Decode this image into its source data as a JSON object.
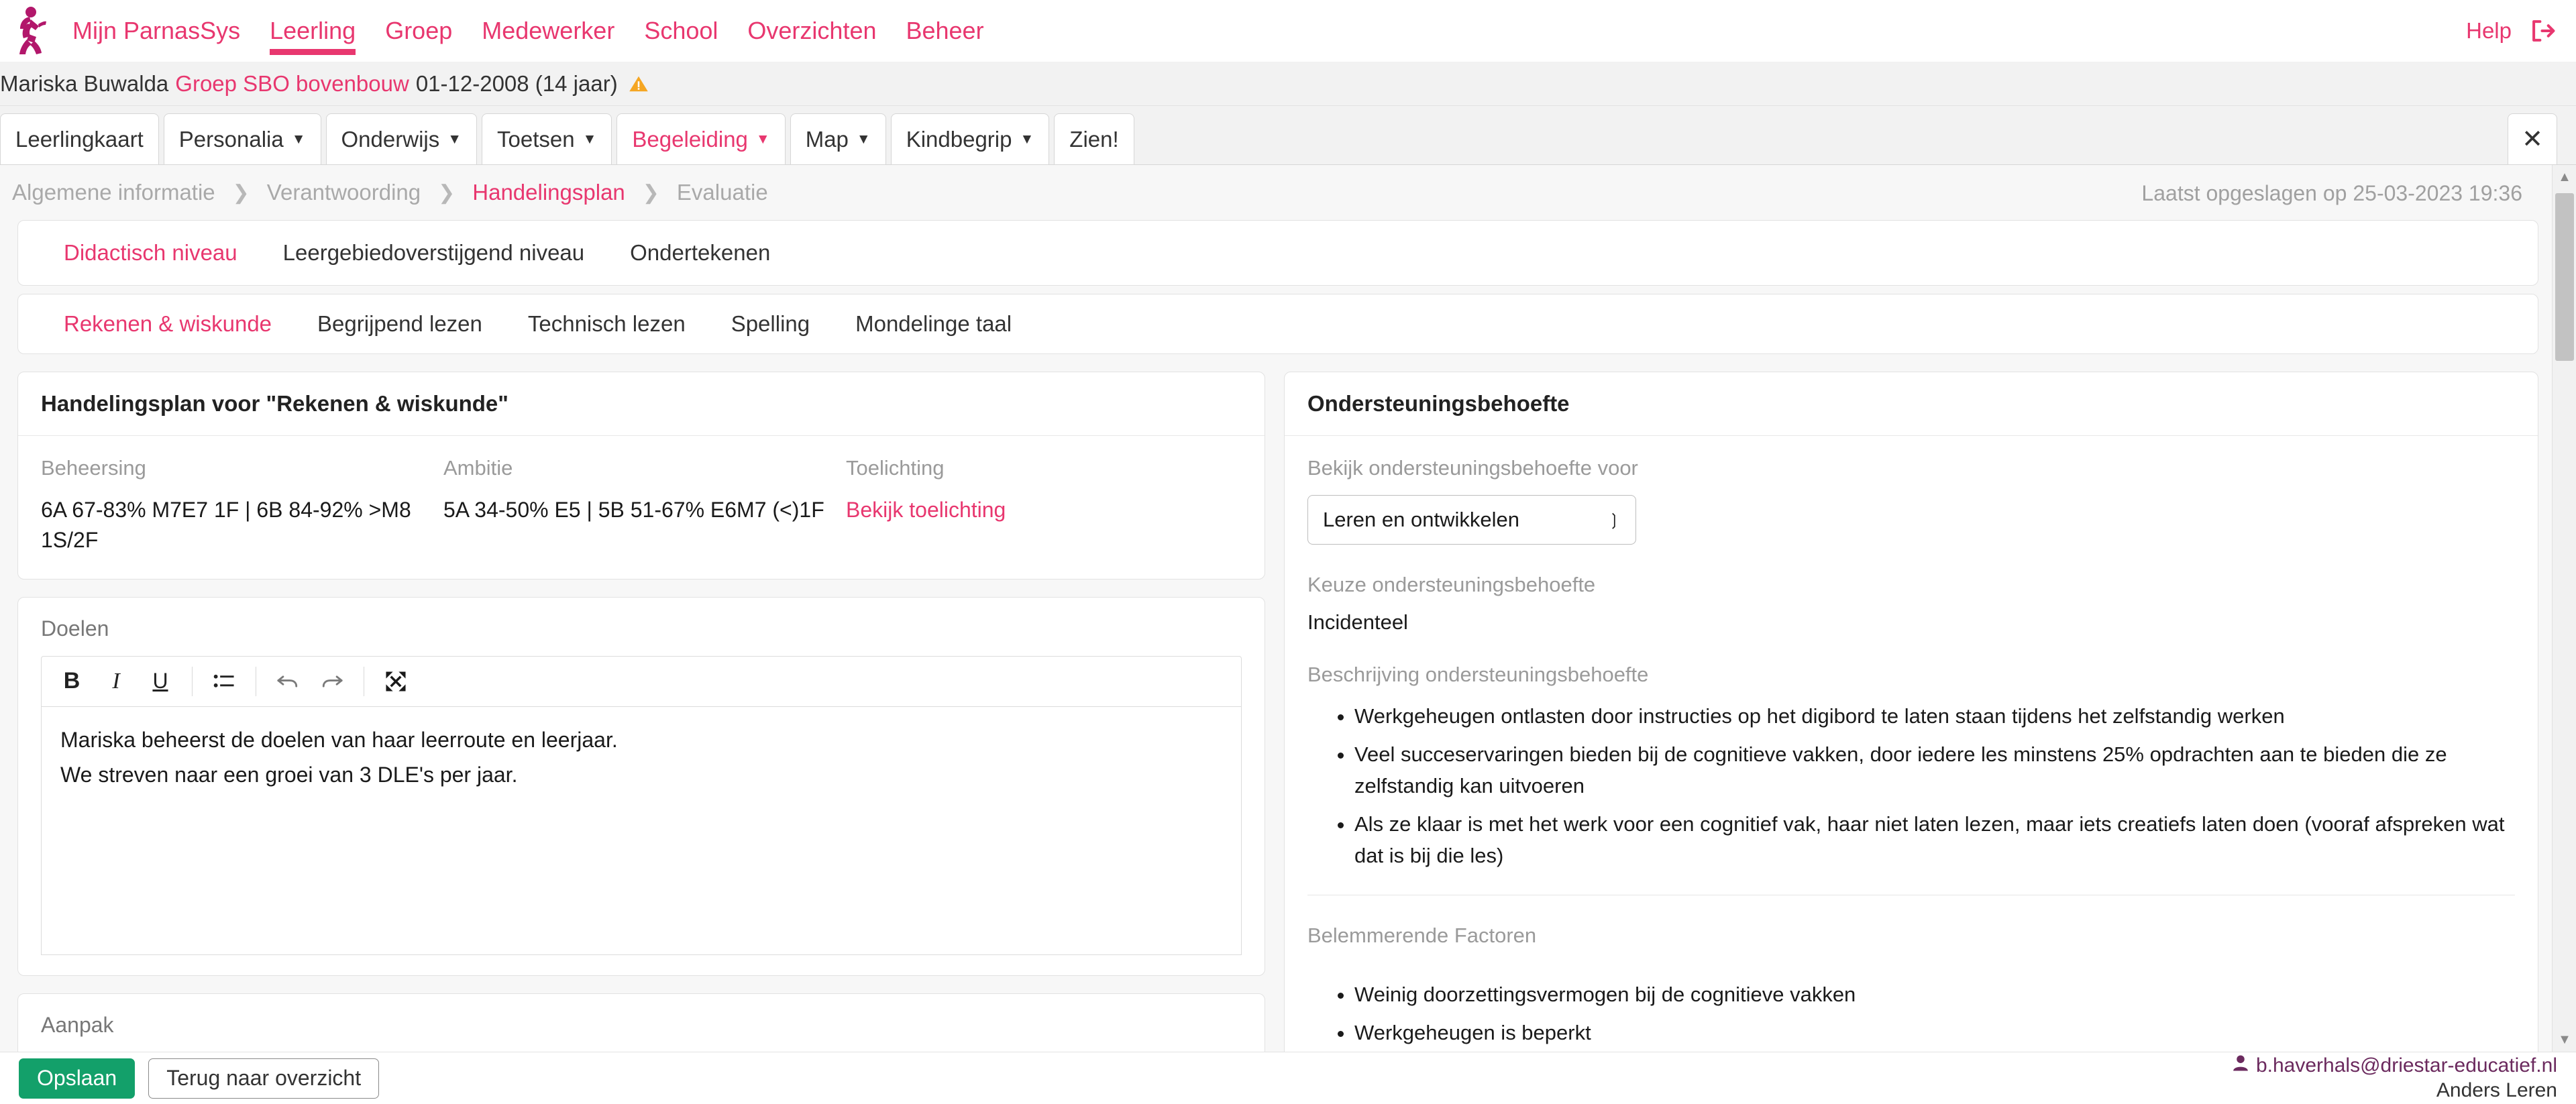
{
  "topnav": {
    "logo_alt": "parnassys-runner-logo",
    "items": [
      {
        "label": "Mijn ParnasSys",
        "active": false
      },
      {
        "label": "Leerling",
        "active": true
      },
      {
        "label": "Groep",
        "active": false
      },
      {
        "label": "Medewerker",
        "active": false
      },
      {
        "label": "School",
        "active": false
      },
      {
        "label": "Overzichten",
        "active": false
      },
      {
        "label": "Beheer",
        "active": false
      }
    ],
    "help_label": "Help"
  },
  "student": {
    "name": "Mariska Buwalda",
    "group": "Groep SBO bovenbouw",
    "dob": "01-12-2008 (14 jaar)"
  },
  "module_tabs": [
    {
      "label": "Leerlingkaart",
      "caret": false,
      "active": false
    },
    {
      "label": "Personalia",
      "caret": true,
      "active": false
    },
    {
      "label": "Onderwijs",
      "caret": true,
      "active": false
    },
    {
      "label": "Toetsen",
      "caret": true,
      "active": false
    },
    {
      "label": "Begeleiding",
      "caret": true,
      "active": true
    },
    {
      "label": "Map",
      "caret": true,
      "active": false
    },
    {
      "label": "Kindbegrip",
      "caret": true,
      "active": false
    },
    {
      "label": "Zien!",
      "caret": false,
      "active": false
    }
  ],
  "close_label": "✕",
  "breadcrumb": {
    "items": [
      {
        "label": "Algemene informatie",
        "active": false
      },
      {
        "label": "Verantwoording",
        "active": false
      },
      {
        "label": "Handelingsplan",
        "active": true
      },
      {
        "label": "Evaluatie",
        "active": false
      }
    ],
    "separator": "❯",
    "saved_info": "Laatst opgeslagen op 25-03-2023 19:36"
  },
  "level_tabs": [
    {
      "label": "Didactisch niveau",
      "active": true
    },
    {
      "label": "Leergebiedoverstijgend niveau",
      "active": false
    },
    {
      "label": "Ondertekenen",
      "active": false
    }
  ],
  "subject_tabs": [
    {
      "label": "Rekenen & wiskunde",
      "active": true
    },
    {
      "label": "Begrijpend lezen",
      "active": false
    },
    {
      "label": "Technisch lezen",
      "active": false
    },
    {
      "label": "Spelling",
      "active": false
    },
    {
      "label": "Mondelinge taal",
      "active": false
    }
  ],
  "plan": {
    "title": "Handelingsplan voor \"Rekenen & wiskunde\"",
    "beheersing_label": "Beheersing",
    "beheersing_value": "6A 67-83% M7E7 1F | 6B 84-92% >M8 1S/2F",
    "ambitie_label": "Ambitie",
    "ambitie_value": "5A 34-50% E5 | 5B 51-67% E6M7 (<)1F",
    "toelichting_label": "Toelichting",
    "toelichting_link": "Bekijk toelichting"
  },
  "doelen": {
    "label": "Doelen",
    "toolbar": {
      "bold": "B",
      "italic": "I",
      "underline": "U",
      "list": "list-icon",
      "undo": "↶",
      "redo": "↷",
      "fullscreen": "fullscreen-icon"
    },
    "line1": "Mariska beheerst de doelen van haar leerroute en leerjaar.",
    "line2": "We streven naar een groei van 3 DLE's per jaar."
  },
  "aanpak": {
    "label": "Aanpak"
  },
  "support": {
    "title": "Ondersteuningsbehoefte",
    "select_label": "Bekijk ondersteuningsbehoefte voor",
    "select_value": "Leren en ontwikkelen",
    "keuze_label": "Keuze ondersteuningsbehoefte",
    "keuze_value": "Incidenteel",
    "beschrijving_label": "Beschrijving ondersteuningsbehoefte",
    "beschrijving_items": [
      "Werkgeheugen ontlasten door instructies op het digibord te laten staan tijdens het zelfstandig werken",
      "Veel succeservaringen bieden bij de cognitieve vakken, door iedere les minstens 25% opdrachten aan te bieden die ze zelfstandig kan uitvoeren",
      "Als ze klaar is met het werk voor een cognitief vak, haar niet laten lezen, maar iets creatiefs laten doen (vooraf afspreken wat dat is bij die les)"
    ],
    "belemmerende_label": "Belemmerende Factoren",
    "belemmerende_items": [
      "Weinig doorzettingsvermogen bij de cognitieve vakken",
      "Werkgeheugen is beperkt"
    ]
  },
  "footer": {
    "save_label": "Opslaan",
    "back_label": "Terug naar overzicht",
    "user_email": "b.haverhals@driestar-educatief.nl",
    "user_school": "Anders Leren"
  },
  "colors": {
    "brand_pink": "#e8376f",
    "save_green": "#13a06a",
    "warning_amber": "#f5a623",
    "user_purple": "#6b2a5e"
  }
}
